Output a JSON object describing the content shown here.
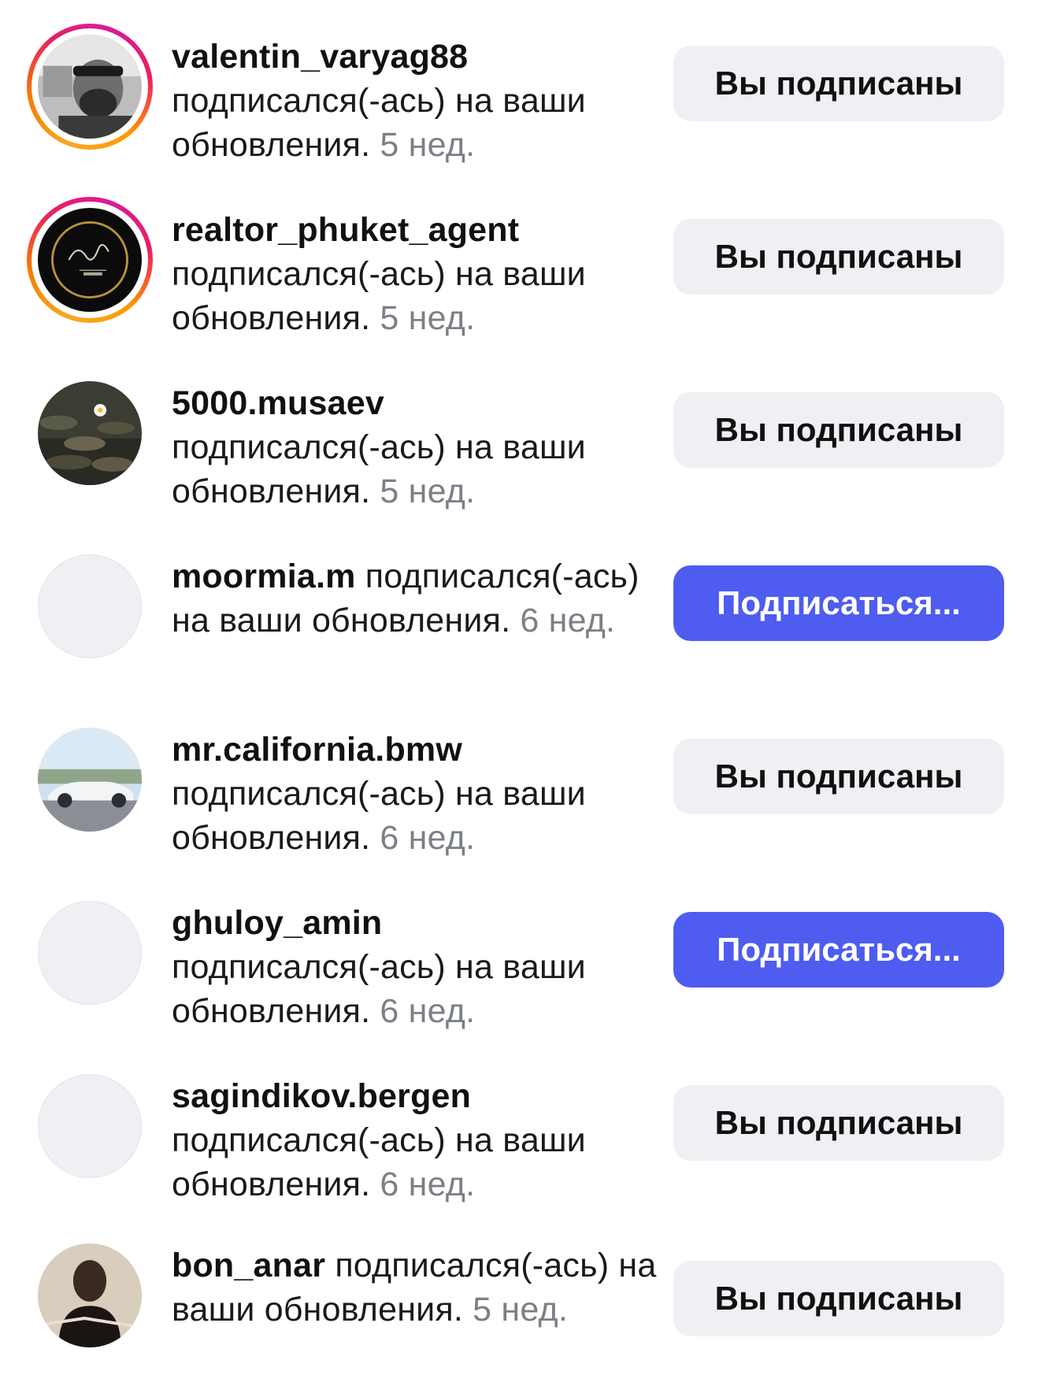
{
  "notifications": [
    {
      "username": "valentin_varyag88",
      "action": "подписался(-ась) на ваши обновления.",
      "time": "5 нед.",
      "button_label": "Вы подписаны",
      "button_state": "following",
      "avatar_icon": "photo-avatar",
      "story_ring": true
    },
    {
      "username": "realtor_phuket_agent",
      "action": "подписался(-ась) на ваши обновления.",
      "time": "5 нед.",
      "button_label": "Вы подписаны",
      "button_state": "following",
      "avatar_icon": "estate-agent-logo",
      "story_ring": true
    },
    {
      "username": "5000.musaev",
      "action": "подписался(-ась) на ваши обновления.",
      "time": "5 нед.",
      "button_label": "Вы подписаны",
      "button_state": "following",
      "avatar_icon": "photo-avatar",
      "story_ring": false
    },
    {
      "username": "moormia.m",
      "action": "подписался(-ась) на ваши обновления.",
      "time": "6 нед.",
      "button_label": "Подписаться...",
      "button_state": "follow",
      "avatar_icon": "empty-avatar",
      "story_ring": false
    },
    {
      "username": "mr.california.bmw",
      "action": "подписался(-ась) на ваши обновления.",
      "time": "6 нед.",
      "button_label": "Вы подписаны",
      "button_state": "following",
      "avatar_icon": "car-photo-avatar",
      "story_ring": false
    },
    {
      "username": "ghuloy_amin",
      "action": "подписался(-ась) на ваши обновления.",
      "time": "6 нед.",
      "button_label": "Подписаться...",
      "button_state": "follow",
      "avatar_icon": "empty-avatar",
      "story_ring": false
    },
    {
      "username": "sagindikov.bergen",
      "action": "подписался(-ась) на ваши обновления.",
      "time": "6 нед.",
      "button_label": "Вы подписаны",
      "button_state": "following",
      "avatar_icon": "empty-avatar",
      "story_ring": false
    },
    {
      "username": "bon_anar",
      "action": "подписался(-ась) на ваши обновления.",
      "time": "5 нед.",
      "button_label": "Вы подписаны",
      "button_state": "following",
      "avatar_icon": "photo-avatar",
      "story_ring": false
    }
  ],
  "colors": {
    "follow_button": "#4e5cf0",
    "following_button": "#eef0f3",
    "time_text": "#7b7f86"
  }
}
